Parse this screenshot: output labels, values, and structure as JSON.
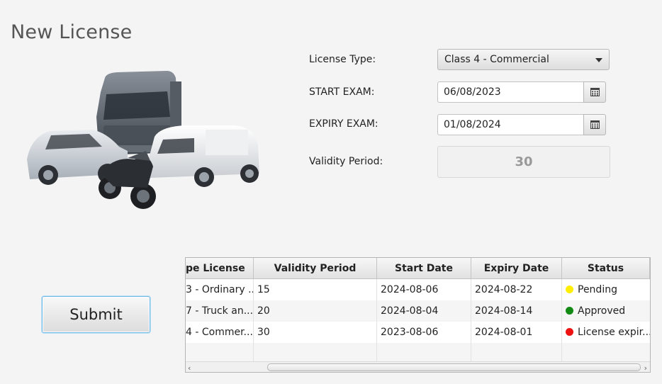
{
  "page": {
    "title": "New License"
  },
  "form": {
    "license_type_label": "License Type:",
    "license_type_value": "Class 4 - Commercial",
    "start_exam_label": "START EXAM:",
    "start_exam_value": "06/08/2023",
    "expiry_exam_label": "EXPIRY EXAM:",
    "expiry_exam_value": "01/08/2024",
    "validity_label": "Validity Period:",
    "validity_value": "30"
  },
  "submit_label": "Submit",
  "table": {
    "columns": [
      "pe License",
      "Validity Period",
      "Start Date",
      "Expiry Date",
      "Status"
    ],
    "rows": [
      {
        "type": "3 - Ordinary ...",
        "validity": "15",
        "start": "2024-08-06",
        "expiry": "2024-08-22",
        "status": "Pending",
        "status_color": "#ffee00"
      },
      {
        "type": "7 - Truck an...",
        "validity": "20",
        "start": "2024-08-04",
        "expiry": "2024-08-14",
        "status": "Approved",
        "status_color": "#138a13"
      },
      {
        "type": "4 - Commer...",
        "validity": "30",
        "start": "2023-08-06",
        "expiry": "2024-08-01",
        "status": "License expir...",
        "status_color": "#ee1111"
      }
    ],
    "scroll_left": "‹",
    "scroll_right": "›"
  },
  "icons": {
    "calendar": "calendar-icon",
    "dropdown": "chevron-down-icon",
    "vehicles": "vehicles-illustration"
  }
}
